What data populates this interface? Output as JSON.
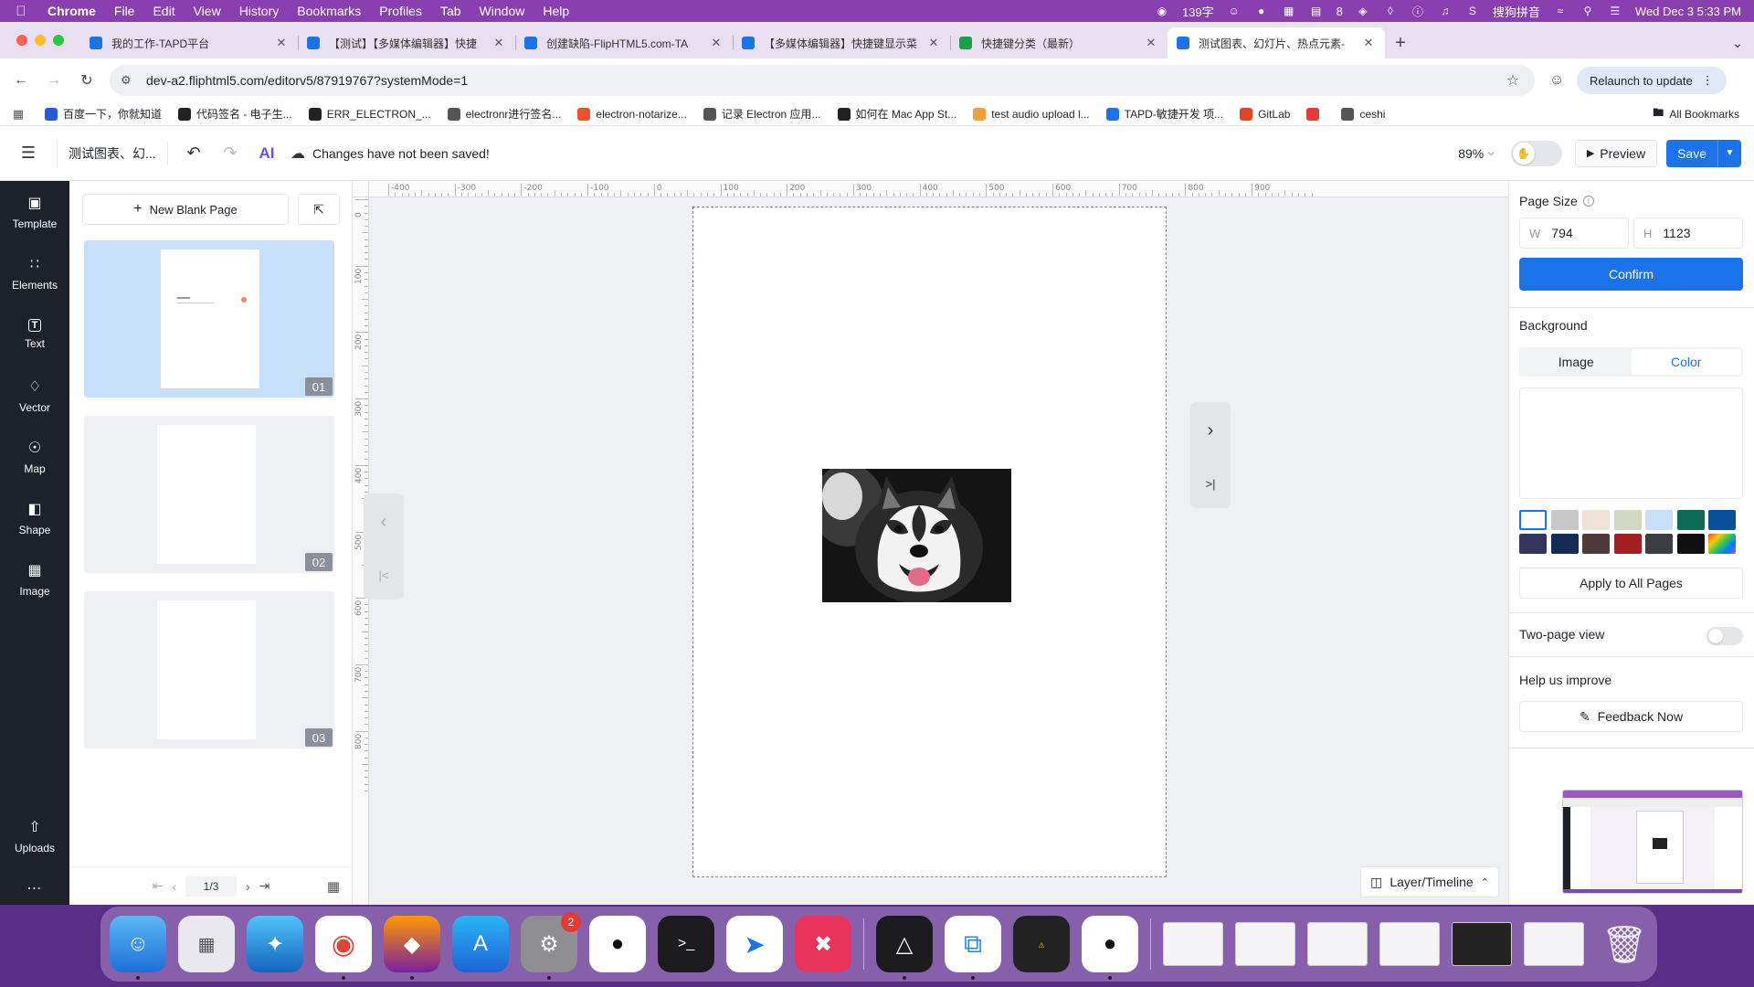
{
  "menubar": {
    "app_name": "Chrome",
    "items": [
      "File",
      "Edit",
      "View",
      "History",
      "Bookmarks",
      "Profiles",
      "Tab",
      "Window",
      "Help"
    ],
    "word_count": "139字",
    "wifi_count": "8",
    "input_method": "搜狗拼音",
    "datetime": "Wed Dec 3  5:33 PM"
  },
  "tabs": [
    {
      "title": "我的工作-TAPD平台",
      "color": "#1a73e8"
    },
    {
      "title": "【测试】【多媒体编辑器】快捷",
      "color": "#1a73e8"
    },
    {
      "title": "创建缺陷-FlipHTML5.com-TA",
      "color": "#1a73e8"
    },
    {
      "title": "【多媒体编辑器】快捷键显示菜",
      "color": "#1a73e8"
    },
    {
      "title": "快捷键分类（最新）",
      "color": "#1e9e4a"
    },
    {
      "title": "测试图表、幻灯片、热点元素-",
      "color": "#1a73e8"
    }
  ],
  "address_bar": {
    "url": "dev-a2.fliphtml5.com/editorv5/87919767?systemMode=1",
    "relaunch_label": "Relaunch to update"
  },
  "bookmarks": [
    {
      "label": "百度一下，你就知道",
      "color": "#2a5bd7"
    },
    {
      "label": "代码签名 - 电子生...",
      "color": "#222222"
    },
    {
      "label": "ERR_ELECTRON_...",
      "color": "#222222"
    },
    {
      "label": "electronr进行签名...",
      "color": "#555555"
    },
    {
      "label": "electron-notarize...",
      "color": "#e8532a"
    },
    {
      "label": "记录 Electron 应用...",
      "color": "#555555"
    },
    {
      "label": "如何在 Mac App St...",
      "color": "#222222"
    },
    {
      "label": "test audio upload l...",
      "color": "#f2a03a"
    },
    {
      "label": "TAPD-敏捷开发 项...",
      "color": "#1a73e8"
    },
    {
      "label": "GitLab",
      "color": "#e24329"
    },
    {
      "label": "",
      "color": "#e53935"
    },
    {
      "label": "ceshi",
      "color": "#555555"
    }
  ],
  "bookmarks_all": "All Bookmarks",
  "editor": {
    "doc_title": "测试图表、幻...",
    "save_status": "Changes have not been saved!",
    "zoom": "89%",
    "preview_label": "Preview",
    "save_label": "Save"
  },
  "left_rail": {
    "items": [
      "Template",
      "Elements",
      "Text",
      "Vector",
      "Map",
      "Shape",
      "Image"
    ],
    "uploads": "Uploads"
  },
  "page_panel": {
    "new_page_label": "New Blank Page",
    "pages": [
      "01",
      "02",
      "03"
    ],
    "pager": "1/3"
  },
  "rulers": {
    "h_labels": [
      "-400",
      "-300",
      "-200",
      "-100",
      "0",
      "100",
      "200",
      "300",
      "400",
      "500",
      "600",
      "700",
      "800",
      "900"
    ],
    "v_labels": [
      "0",
      "100",
      "200",
      "300",
      "400",
      "500",
      "600",
      "700",
      "800"
    ]
  },
  "canvas": {
    "layer_timeline_label": "Layer/Timeline"
  },
  "right_panel": {
    "page_size_label": "Page Size",
    "width_key": "W",
    "width_value": "794",
    "height_key": "H",
    "height_value": "1123",
    "confirm_label": "Confirm",
    "background_label": "Background",
    "tab_image": "Image",
    "tab_color": "Color",
    "swatches": [
      "#ffffff",
      "#c8c8c8",
      "#ece3d6",
      "#d2d9c2",
      "#c8dffb",
      "#0e6b55",
      "#0a4f9e",
      "#34355e",
      "#132a52",
      "#4e3b39",
      "#a31f22",
      "#3b3e42",
      "#111111",
      "rainbow"
    ],
    "apply_all_label": "Apply to All Pages",
    "two_page_label": "Two-page view",
    "help_label": "Help us improve",
    "feedback_label": "Feedback Now"
  }
}
